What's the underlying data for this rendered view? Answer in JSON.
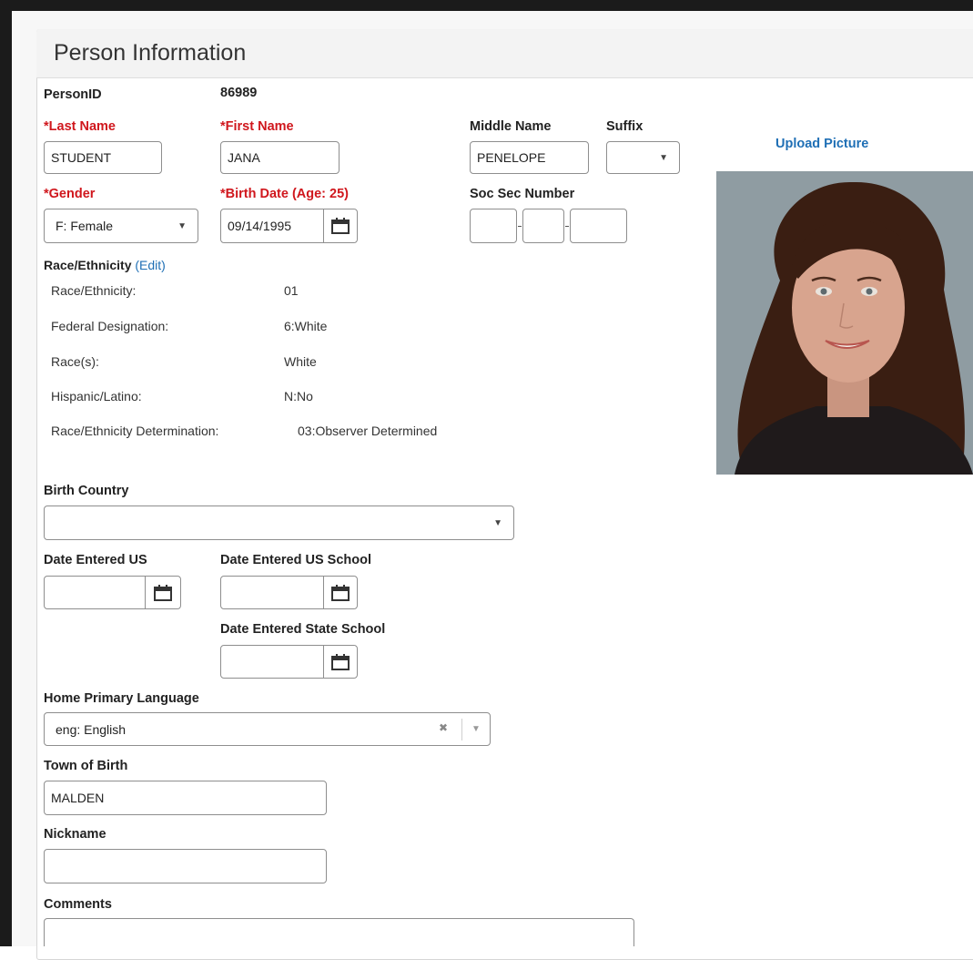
{
  "panel": {
    "title": "Person Information"
  },
  "person_id": {
    "label": "PersonID",
    "value": "86989"
  },
  "last_name": {
    "label": "*Last Name",
    "value": "STUDENT"
  },
  "first_name": {
    "label": "*First Name",
    "value": "JANA"
  },
  "middle_name": {
    "label": "Middle Name",
    "value": "PENELOPE"
  },
  "suffix": {
    "label": "Suffix",
    "value": ""
  },
  "gender": {
    "label": "*Gender",
    "value": "F: Female"
  },
  "birth_date": {
    "label": "*Birth Date (Age: 25)",
    "value": "09/14/1995"
  },
  "ssn": {
    "label": "Soc Sec Number"
  },
  "race": {
    "label": "Race/Ethnicity",
    "edit_open": "(",
    "edit_link": "Edit",
    "edit_close": ")",
    "rows": [
      {
        "label": "Race/Ethnicity:",
        "value": "01"
      },
      {
        "label": "Federal Designation:",
        "value": "6:White"
      },
      {
        "label": "Race(s):",
        "value": "White"
      },
      {
        "label": "Hispanic/Latino:",
        "value": "N:No"
      },
      {
        "label": "Race/Ethnicity Determination:",
        "value": "03:Observer Determined"
      }
    ]
  },
  "birth_country": {
    "label": "Birth Country",
    "value": ""
  },
  "date_entered_us": {
    "label": "Date Entered US",
    "value": ""
  },
  "date_entered_us_school": {
    "label": "Date Entered US School",
    "value": ""
  },
  "date_entered_state_school": {
    "label": "Date Entered State School",
    "value": ""
  },
  "home_language": {
    "label": "Home Primary Language",
    "value": "eng: English",
    "clear_glyph": "✖"
  },
  "town_of_birth": {
    "label": "Town of Birth",
    "value": "MALDEN"
  },
  "nickname": {
    "label": "Nickname",
    "value": ""
  },
  "comments": {
    "label": "Comments",
    "value": ""
  },
  "picture": {
    "upload_label": "Upload Picture"
  },
  "icons": {
    "calendar": "calendar-icon",
    "dropdown": "chevron-down-icon",
    "clear": "clear-icon"
  },
  "colors": {
    "required": "#d0171d",
    "link": "#1f6fb5"
  }
}
